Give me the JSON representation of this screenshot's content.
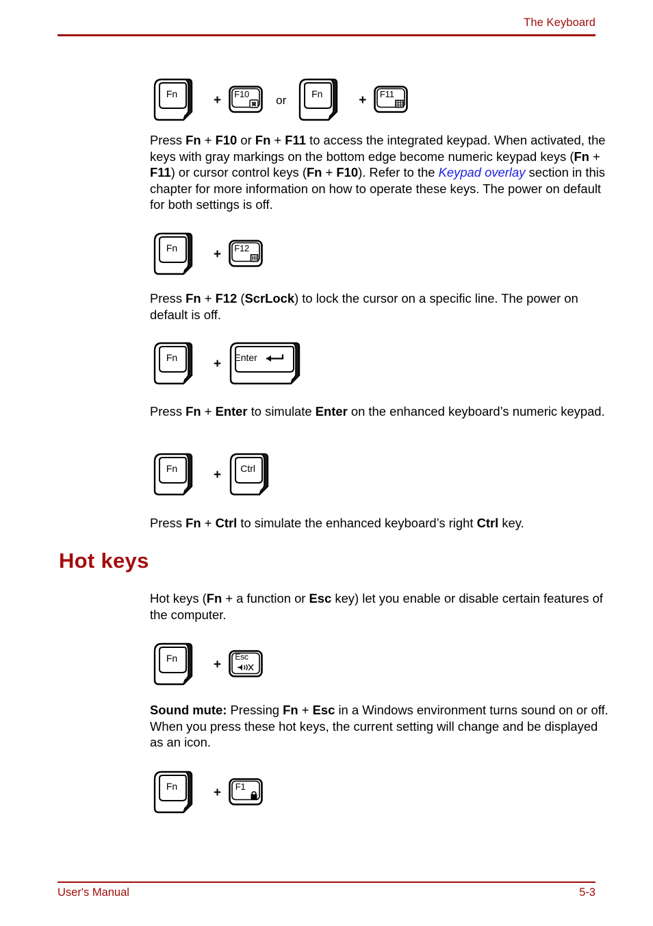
{
  "page": {
    "header_title": "The Keyboard",
    "footer_left": "User's Manual",
    "footer_page": "5-3",
    "accent_color": "#9e0b0b",
    "heading_color": "#a50c0c",
    "link_color": "#2020e0",
    "body_color": "#000000"
  },
  "key_rows": [
    {
      "id": "row-f10-f11",
      "items": [
        {
          "type": "key3d",
          "label": "Fn",
          "name": "key-fn"
        },
        {
          "type": "operator",
          "label": "+",
          "name": "plus-operator"
        },
        {
          "type": "keyflat",
          "label": "F10",
          "glyph": "cursor-overlay-icon",
          "name": "key-f10"
        },
        {
          "type": "operator",
          "label": "or",
          "name": "or-operator"
        },
        {
          "type": "key3d",
          "label": "Fn",
          "name": "key-fn"
        },
        {
          "type": "operator",
          "label": "+",
          "name": "plus-operator"
        },
        {
          "type": "keyflat",
          "label": "F11",
          "glyph": "numeric-keypad-icon",
          "name": "key-f11"
        }
      ]
    },
    {
      "id": "row-f12",
      "items": [
        {
          "type": "key3d",
          "label": "Fn",
          "name": "key-fn"
        },
        {
          "type": "operator",
          "label": "+",
          "name": "plus-operator"
        },
        {
          "type": "keyflat",
          "label": "F12",
          "glyph": "scrlock-icon",
          "name": "key-f12"
        }
      ]
    },
    {
      "id": "row-enter",
      "items": [
        {
          "type": "key3d",
          "label": "Fn",
          "name": "key-fn"
        },
        {
          "type": "operator",
          "label": "+",
          "name": "plus-operator"
        },
        {
          "type": "key3dwide",
          "label": "Enter",
          "glyph": "enter-arrow-icon",
          "name": "key-enter"
        }
      ]
    },
    {
      "id": "row-ctrl",
      "items": [
        {
          "type": "key3d",
          "label": "Fn",
          "name": "key-fn"
        },
        {
          "type": "operator",
          "label": "+",
          "name": "plus-operator"
        },
        {
          "type": "key3d",
          "label": "Ctrl",
          "name": "key-ctrl"
        }
      ]
    },
    {
      "id": "row-esc",
      "items": [
        {
          "type": "key3d",
          "label": "Fn",
          "name": "key-fn"
        },
        {
          "type": "operator",
          "label": "+",
          "name": "plus-operator"
        },
        {
          "type": "keyflat",
          "label": "Esc",
          "glyph": "sound-mute-icon",
          "name": "key-esc"
        }
      ]
    },
    {
      "id": "row-f1",
      "items": [
        {
          "type": "key3d",
          "label": "Fn",
          "name": "key-fn"
        },
        {
          "type": "operator",
          "label": "+",
          "name": "plus-operator"
        },
        {
          "type": "keyflat",
          "label": "F1",
          "glyph": "lock-icon",
          "name": "key-f1"
        }
      ]
    }
  ],
  "paragraphs": {
    "keypad": {
      "p1": "Press ",
      "b1": "Fn",
      "p2": " + ",
      "b2": "F10",
      "p3": " or ",
      "b3": "Fn",
      "p4": " + ",
      "b4": "F11",
      "p5": " to access the integrated keypad. When activated, the keys with gray markings on the bottom edge become numeric keypad keys (",
      "b5": "Fn",
      "p6": " + ",
      "b6": "F11",
      "p7": ") or cursor control keys (",
      "b7": "Fn",
      "p8": " + ",
      "b8": "F10",
      "p9": "). Refer to the ",
      "link": "Keypad overlay",
      "p10": " section in this chapter for more information on how to operate these keys. The power on default for both settings is off."
    },
    "scrlock": {
      "p1": "Press ",
      "b1": "Fn",
      "p2": " + ",
      "b2": "F12",
      "p3": " (",
      "b3": "ScrLock",
      "p4": ") to lock the cursor on a specific line. The power on default is off."
    },
    "enter": {
      "p1": "Press ",
      "b1": "Fn",
      "p2": " + ",
      "b2": "Enter",
      "p3": " to simulate ",
      "b3": "Enter",
      "p4": " on the enhanced keyboard’s numeric keypad."
    },
    "ctrl": {
      "p1": "Press ",
      "b1": "Fn",
      "p2": " + ",
      "b2": "Ctrl",
      "p3": " to simulate the enhanced keyboard’s right ",
      "b3": "Ctrl",
      "p4": " key."
    },
    "hotkeys_intro": {
      "p1": "Hot keys (",
      "b1": "Fn",
      "p2": " + a function or ",
      "b2": "Esc",
      "p3": " key) let you enable or disable certain features of the computer."
    },
    "sound_mute": {
      "b1": "Sound mute:",
      "p1": " Pressing ",
      "b2": "Fn",
      "p2": " + ",
      "b3": "Esc",
      "p3": " in a Windows environment turns sound on or off. When you press these hot keys, the current setting will change and be displayed as an icon."
    }
  },
  "headings": {
    "hot_keys": "Hot keys"
  }
}
